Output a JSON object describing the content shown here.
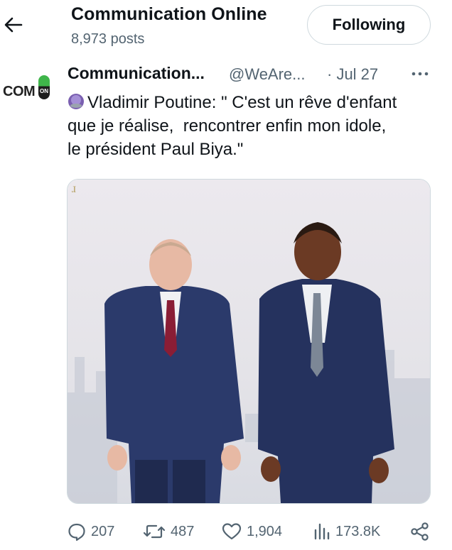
{
  "header": {
    "back_icon": "arrow-left-icon",
    "title": "Communication Online",
    "subtitle": "8,973 posts",
    "follow_label": "Following"
  },
  "tweet": {
    "avatar_text": "COM",
    "avatar_badge": "ON",
    "author_name": "Communication...",
    "handle": "@WeAre...",
    "date": "· Jul 27",
    "more_icon": "more-horizontal-icon",
    "emoji_icon": "purple-circle-emoji-icon",
    "text_lines": [
      "Vladimir Poutine: \" C'est un rêve d'enfant",
      "que je réalise,  rencontrer enfin mon idole,",
      "le président Paul Biya.\""
    ],
    "media_icon": "photo-icon",
    "accent_colors": {
      "suit_blue": "#1f2d52",
      "backdrop": "#e7e6ea"
    }
  },
  "actions": {
    "replies": "207",
    "retweets": "487",
    "likes": "1,904",
    "views": "173.8K",
    "share_icon": "share-icon"
  }
}
